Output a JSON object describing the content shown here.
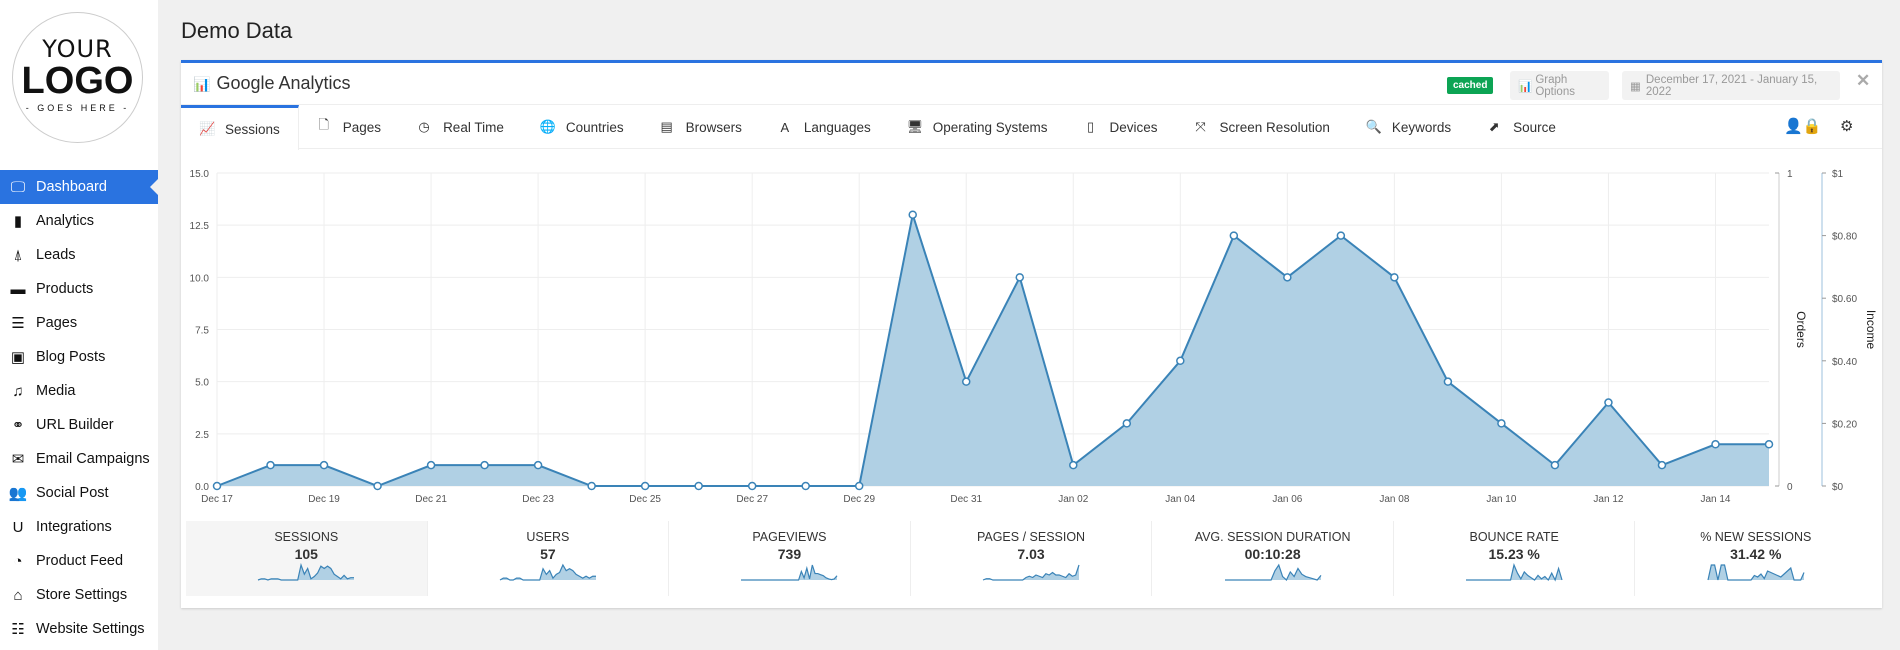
{
  "logo": {
    "line1": "YOUR",
    "line2": "LOGO",
    "line3": "- GOES HERE -"
  },
  "sidebar": {
    "items": [
      {
        "label": "Dashboard",
        "icon": "monitor-icon",
        "glyph": "🖵",
        "active": true
      },
      {
        "label": "Analytics",
        "icon": "bar-chart-icon",
        "glyph": "▮"
      },
      {
        "label": "Leads",
        "icon": "person-pin-icon",
        "glyph": "⍋"
      },
      {
        "label": "Products",
        "icon": "archive-box-icon",
        "glyph": "▬"
      },
      {
        "label": "Pages",
        "icon": "list-icon",
        "glyph": "☰"
      },
      {
        "label": "Blog Posts",
        "icon": "newspaper-icon",
        "glyph": "▣"
      },
      {
        "label": "Media",
        "icon": "media-icon",
        "glyph": "♫"
      },
      {
        "label": "URL Builder",
        "icon": "link-icon",
        "glyph": "⚭"
      },
      {
        "label": "Email Campaigns",
        "icon": "envelope-icon",
        "glyph": "✉"
      },
      {
        "label": "Social Post",
        "icon": "users-icon",
        "glyph": "👥"
      },
      {
        "label": "Integrations",
        "icon": "magnet-icon",
        "glyph": "U"
      },
      {
        "label": "Product Feed",
        "icon": "rss-icon",
        "glyph": "◔"
      },
      {
        "label": "Store Settings",
        "icon": "store-icon",
        "glyph": "⌂"
      },
      {
        "label": "Website Settings",
        "icon": "sliders-icon",
        "glyph": "☷"
      }
    ]
  },
  "page": {
    "title": "Demo Data"
  },
  "panel": {
    "title": "Google Analytics",
    "badge": "cached",
    "graph_options": "Graph Options",
    "date_range": "December 17, 2021 - January 15, 2022",
    "close": "✕"
  },
  "tabs": [
    {
      "label": "Sessions",
      "icon": "line-chart-icon",
      "glyph": "📈",
      "active": true
    },
    {
      "label": "Pages",
      "icon": "file-icon",
      "glyph": "🗋"
    },
    {
      "label": "Real Time",
      "icon": "clock-icon",
      "glyph": "◷"
    },
    {
      "label": "Countries",
      "icon": "globe-icon",
      "glyph": "🌐"
    },
    {
      "label": "Browsers",
      "icon": "browser-icon",
      "glyph": "▤"
    },
    {
      "label": "Languages",
      "icon": "font-icon",
      "glyph": "A"
    },
    {
      "label": "Operating Systems",
      "icon": "desktop-icon",
      "glyph": "🖥"
    },
    {
      "label": "Devices",
      "icon": "tablet-icon",
      "glyph": "▯"
    },
    {
      "label": "Screen Resolution",
      "icon": "expand-icon",
      "glyph": "⤧"
    },
    {
      "label": "Keywords",
      "icon": "search-icon",
      "glyph": "🔍"
    },
    {
      "label": "Source",
      "icon": "external-link-icon",
      "glyph": "⬈"
    }
  ],
  "colors": {
    "accent": "#2a73e0",
    "series_line": "#3a83b7",
    "series_fill": "#b0d0e4",
    "badge": "#0ca454"
  },
  "chart_data": {
    "type": "area",
    "x": [
      "Dec 17",
      "Dec 18",
      "Dec 19",
      "Dec 20",
      "Dec 21",
      "Dec 22",
      "Dec 23",
      "Dec 24",
      "Dec 25",
      "Dec 26",
      "Dec 27",
      "Dec 28",
      "Dec 29",
      "Dec 30",
      "Dec 31",
      "Jan 01",
      "Jan 02",
      "Jan 03",
      "Jan 04",
      "Jan 05",
      "Jan 06",
      "Jan 07",
      "Jan 08",
      "Jan 09",
      "Jan 10",
      "Jan 11",
      "Jan 12",
      "Jan 13",
      "Jan 14",
      "Jan 15"
    ],
    "xticks": [
      "Dec 17",
      "Dec 19",
      "Dec 21",
      "Dec 23",
      "Dec 25",
      "Dec 27",
      "Dec 29",
      "Dec 31",
      "Jan 02",
      "Jan 04",
      "Jan 06",
      "Jan 08",
      "Jan 10",
      "Jan 12",
      "Jan 14"
    ],
    "series": [
      {
        "values": [
          0,
          1,
          1,
          0,
          1,
          1,
          1,
          0,
          0,
          0,
          0,
          0,
          0,
          13,
          5,
          10,
          1,
          3,
          6,
          12,
          10,
          12,
          10,
          5,
          3,
          1,
          4,
          1,
          2,
          2
        ]
      }
    ],
    "ylim": [
      0,
      15
    ],
    "yticks": [
      "0.0",
      "2.5",
      "5.0",
      "7.5",
      "10.0",
      "12.5",
      "15.0"
    ],
    "y2label": "Orders",
    "y2ticks": [
      "0",
      "1"
    ],
    "y3label": "Income",
    "y3ticks": [
      "$0",
      "$0.20",
      "$0.40",
      "$0.60",
      "$0.80",
      "$1"
    ],
    "grid": true
  },
  "stats": [
    {
      "label": "SESSIONS",
      "value": "105",
      "spark": [
        0,
        1,
        1,
        0,
        1,
        1,
        1,
        0,
        0,
        0,
        0,
        0,
        0,
        13,
        5,
        10,
        1,
        3,
        6,
        12,
        10,
        12,
        10,
        5,
        3,
        1,
        4,
        1,
        2,
        2
      ]
    },
    {
      "label": "USERS",
      "value": "57",
      "spark": [
        0,
        1,
        1,
        0,
        0,
        1,
        1,
        0,
        0,
        0,
        0,
        0,
        0,
        6,
        3,
        5,
        1,
        3,
        4,
        8,
        5,
        6,
        5,
        3,
        2,
        1,
        2,
        1,
        2,
        2
      ]
    },
    {
      "label": "PAGEVIEWS",
      "value": "739",
      "spark": [
        0,
        0,
        0,
        0,
        0,
        0,
        0,
        0,
        0,
        0,
        0,
        0,
        0,
        0,
        0,
        0,
        0,
        0,
        0,
        0,
        0,
        0,
        40,
        10,
        55,
        5,
        70,
        30,
        30,
        25,
        20,
        10,
        5,
        2,
        5,
        20
      ]
    },
    {
      "label": "PAGES / SESSION",
      "value": "7.03",
      "spark": [
        0,
        1,
        1,
        0,
        0,
        0,
        0,
        0,
        0,
        0,
        0,
        0,
        0,
        2,
        3,
        2,
        4,
        3,
        2,
        5,
        4,
        6,
        4,
        4,
        3,
        2,
        5,
        3,
        4,
        12
      ]
    },
    {
      "label": "AVG. SESSION DURATION",
      "value": "00:10:28",
      "spark": [
        0,
        0,
        0,
        0,
        0,
        0,
        0,
        0,
        0,
        0,
        0,
        0,
        0,
        8,
        13,
        3,
        0,
        7,
        3,
        10,
        5,
        3,
        2,
        1,
        0,
        4
      ]
    },
    {
      "label": "BOUNCE RATE",
      "value": "15.23 %",
      "spark": [
        0,
        0,
        0,
        0,
        0,
        0,
        0,
        0,
        0,
        0,
        0,
        0,
        0,
        0,
        13,
        6,
        1,
        7,
        4,
        2,
        0,
        4,
        1,
        3,
        0,
        6,
        0,
        10,
        0
      ]
    },
    {
      "label": "% NEW SESSIONS",
      "value": "31.42 %",
      "spark": [
        0,
        10,
        10,
        0,
        10,
        10,
        0,
        0,
        0,
        0,
        0,
        0,
        0,
        0,
        3,
        2,
        4,
        1,
        6,
        5,
        4,
        3,
        2,
        4,
        6,
        8,
        0,
        0,
        0,
        5
      ]
    }
  ]
}
